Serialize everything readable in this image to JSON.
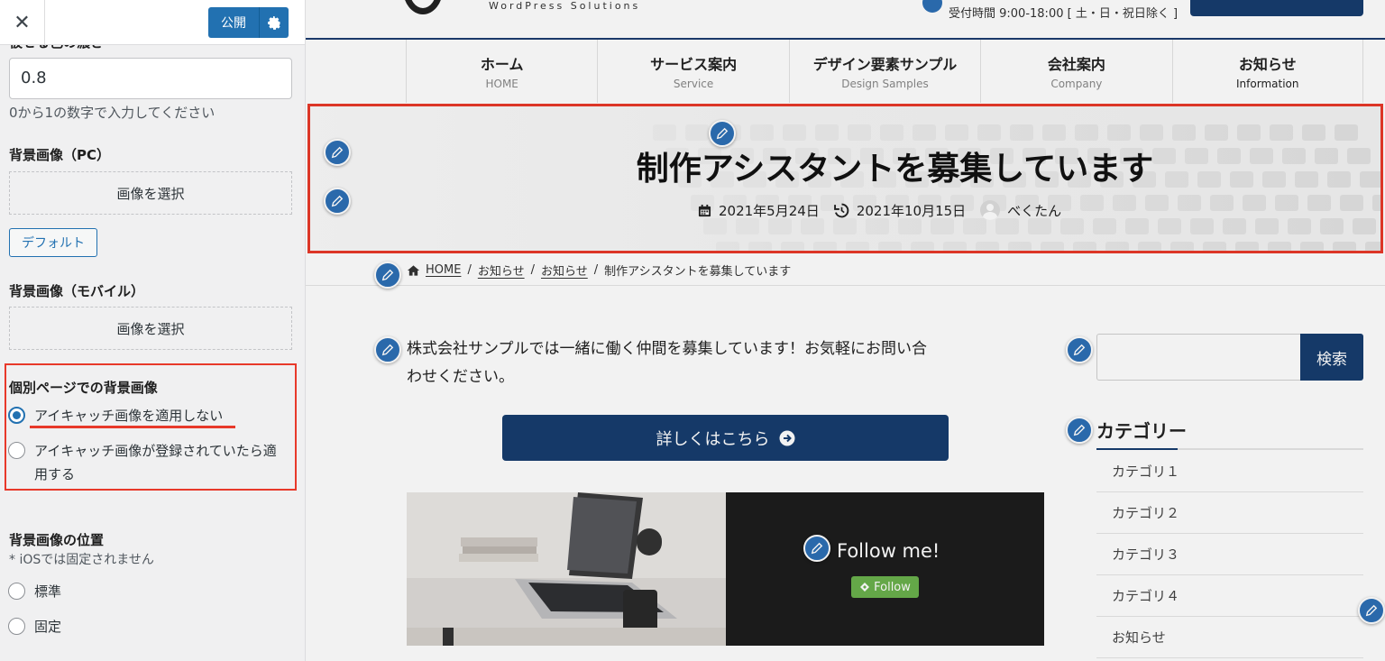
{
  "sidebar": {
    "close_label": "✕",
    "publish_label": "公開",
    "cut_label": "被せる色の濃さ",
    "opacity_value": "0.8",
    "opacity_help": "0から1の数字で入力してください",
    "bg_pc_label": "背景画像（PC）",
    "select_image_label": "画像を選択",
    "default_label": "デフォルト",
    "bg_mobile_label": "背景画像（モバイル）",
    "single_bg_label": "個別ページでの背景画像",
    "single_bg_options": [
      {
        "label": "アイキャッチ画像を適用しない",
        "checked": true
      },
      {
        "label_line1": "アイキャッチ画像が登録されていたら適",
        "label_line2": "用する",
        "checked": false
      }
    ],
    "bg_position_label": "背景画像の位置",
    "bg_position_note": "* iOSでは固定されません",
    "bg_position_options": [
      {
        "label": "標準",
        "checked": false
      },
      {
        "label": "固定",
        "checked": false
      }
    ]
  },
  "preview": {
    "logo_tagline": "WordPress Solutions",
    "hours": "受付時間 9:00-18:00 [ 土・日・祝日除く ]",
    "nav": [
      {
        "label": "ホーム",
        "sub": "HOME"
      },
      {
        "label": "サービス案内",
        "sub": "Service"
      },
      {
        "label": "デザイン要素サンプル",
        "sub": "Design Samples"
      },
      {
        "label": "会社案内",
        "sub": "Company"
      },
      {
        "label": "お知らせ",
        "sub": "Information"
      }
    ],
    "post_title": "制作アシスタントを募集しています",
    "published": "2021年5月24日",
    "updated": "2021年10月15日",
    "author": "べくたん",
    "breadcrumb": [
      "HOME",
      "お知らせ",
      "お知らせ",
      "制作アシスタントを募集しています"
    ],
    "body_text": "株式会社サンプルでは一緒に働く仲間を募集しています！お気軽にお問い合わせください。",
    "more_button": "詳しくはこちら",
    "follow_text": "Follow me!",
    "follow_button": "Follow",
    "search_button": "検索",
    "category_title": "カテゴリー",
    "categories": [
      "カテゴリ１",
      "カテゴリ２",
      "カテゴリ３",
      "カテゴリ４",
      "お知らせ"
    ]
  },
  "colors": {
    "wp_blue": "#2271b1",
    "site_navy": "#173d6e",
    "highlight_red": "#e8392a",
    "pencil_blue": "#2d6fb5",
    "follow_green": "#6ab04c"
  }
}
